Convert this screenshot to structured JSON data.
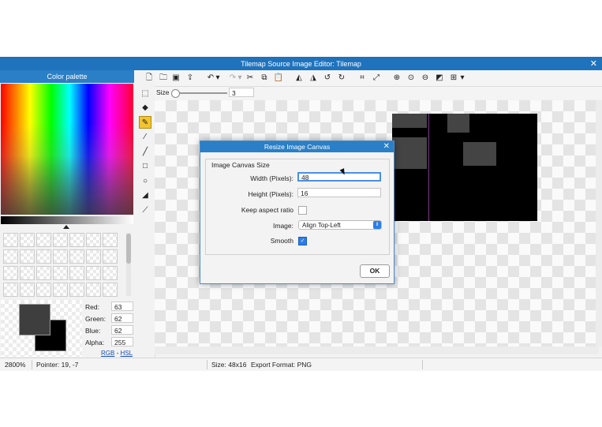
{
  "window": {
    "title": "Tilemap Source Image Editor: Tilemap",
    "close_glyph": "✕"
  },
  "palette": {
    "header": "Color palette",
    "red_label": "Red:",
    "red": "63",
    "green_label": "Green:",
    "green": "62",
    "blue_label": "Blue:",
    "blue": "62",
    "alpha_label": "Alpha:",
    "alpha": "255",
    "rgb_link": "RGB",
    "sep": "-",
    "hsl_link": "HSL",
    "fg_color": "#3f3e3e",
    "bg_color": "#000000"
  },
  "tools": [
    "select-icon",
    "eraser-icon",
    "pencil-icon",
    "brush-icon",
    "line-icon",
    "rectangle-icon",
    "ellipse-icon",
    "fill-bucket-icon",
    "eyedropper-icon"
  ],
  "toolbar": {
    "size_label": "Size",
    "size_value": "3"
  },
  "dialog": {
    "title": "Resize Image Canvas",
    "close_glyph": "✕",
    "group_label": "Image Canvas Size",
    "width_label": "Width (Pixels):",
    "width_value": "48",
    "height_label": "Height (Pixels):",
    "height_value": "16",
    "keep_aspect_label": "Keep aspect ratio",
    "keep_aspect": false,
    "image_label": "Image:",
    "image_value": "Align Top-Left",
    "smooth_label": "Smooth",
    "smooth": true,
    "ok_label": "OK"
  },
  "status": {
    "zoom": "2800%",
    "pointer": "Pointer: 19, -7",
    "size": "Size: 48x16",
    "export": "Export Format: PNG"
  },
  "colors": {
    "accent": "#1f73bd",
    "selected_tool": "#f2c430"
  }
}
